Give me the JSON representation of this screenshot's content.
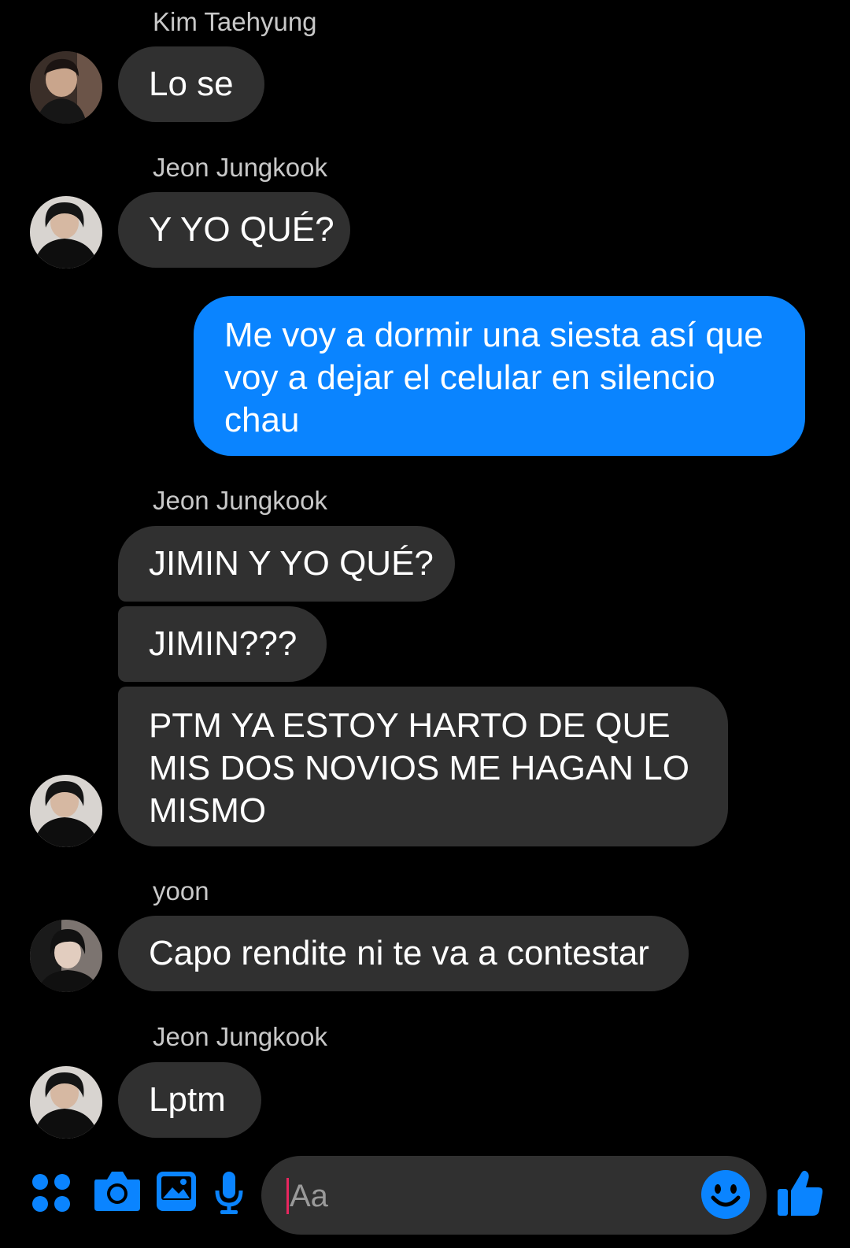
{
  "messages": {
    "kim_name": "Kim Taehyung",
    "kim_msg": "Lo se",
    "jk_name_1": "Jeon Jungkook",
    "jk_msg_1": "Y YO QUÉ?",
    "me_msg": "Me voy a dormir una siesta así que voy a dejar el celular en silencio chau",
    "jk_name_2": "Jeon Jungkook",
    "jk_msg_2a": "JIMIN Y YO QUÉ?",
    "jk_msg_2b": "JIMIN???",
    "jk_msg_2c": "PTM YA ESTOY HARTO DE QUE MIS DOS NOVIOS ME HAGAN LO MISMO",
    "yoon_name": "yoon",
    "yoon_msg": "Capo rendite ni te va a contestar",
    "jk_name_3": "Jeon Jungkook",
    "jk_msg_3": "Lptm"
  },
  "composer": {
    "placeholder": "Aa",
    "icons": [
      "apps-icon",
      "camera-icon",
      "gallery-icon",
      "microphone-icon",
      "emoji-icon",
      "thumbs-up-icon"
    ]
  },
  "colors": {
    "accent": "#0a84ff",
    "bubble_incoming": "#303030",
    "background": "#000000",
    "caret": "#e8265f"
  }
}
